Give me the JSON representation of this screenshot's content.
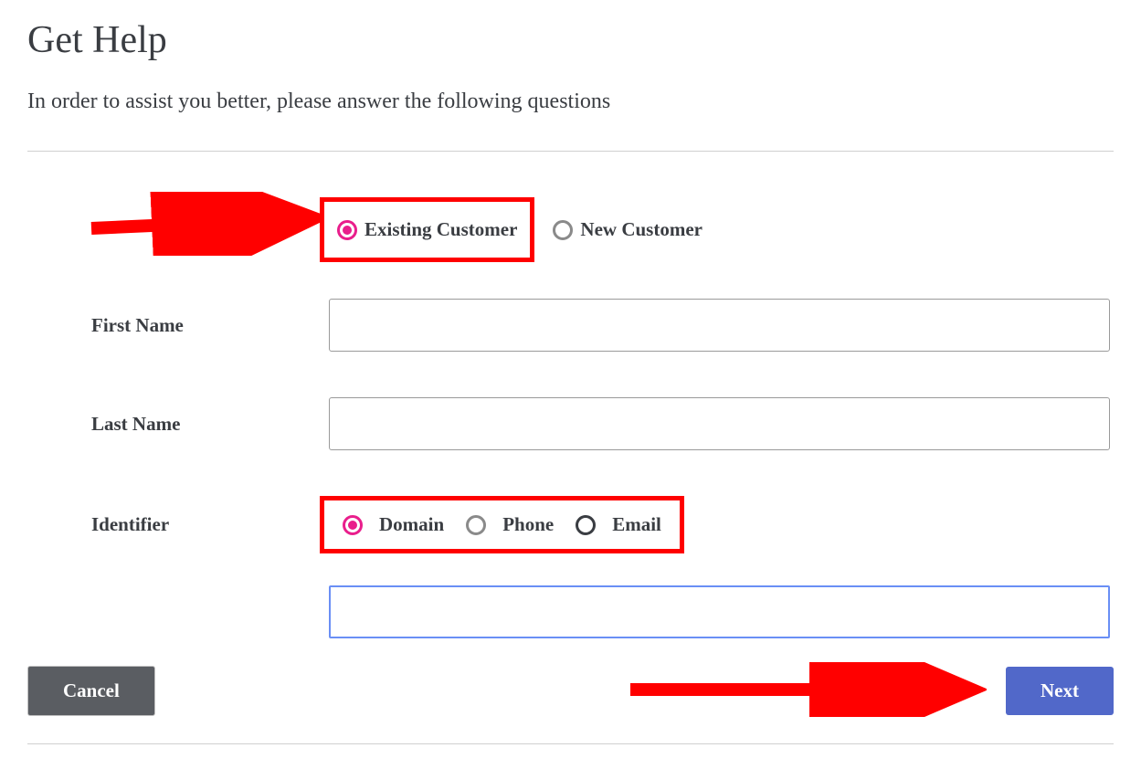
{
  "header": {
    "title": "Get Help",
    "subtitle": "In order to assist you better, please answer the following questions"
  },
  "customerType": {
    "existing_label": "Existing Customer",
    "new_label": "New Customer",
    "selected": "existing"
  },
  "form": {
    "first_name_label": "First Name",
    "first_name_value": "",
    "last_name_label": "Last Name",
    "last_name_value": "",
    "identifier_label": "Identifier",
    "identifier_options": {
      "domain_label": "Domain",
      "phone_label": "Phone",
      "email_label": "Email"
    },
    "identifier_selected": "domain",
    "domain_value": ""
  },
  "buttons": {
    "cancel_label": "Cancel",
    "next_label": "Next"
  }
}
